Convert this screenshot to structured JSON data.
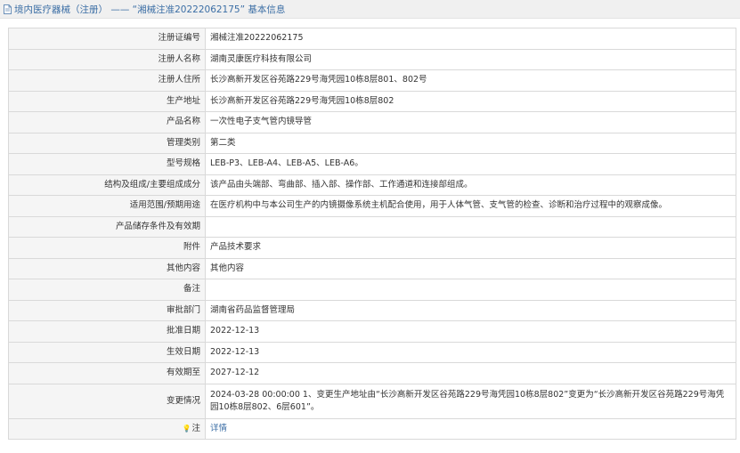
{
  "header": {
    "title": "境内医疗器械（注册） —— “湘械注准20222062175” 基本信息"
  },
  "rows": [
    {
      "label": "注册证编号",
      "value": "湘械注准20222062175"
    },
    {
      "label": "注册人名称",
      "value": "湖南灵康医疗科技有限公司"
    },
    {
      "label": "注册人住所",
      "value": "长沙高新开发区谷苑路229号海凭园10栋8层801、802号"
    },
    {
      "label": "生产地址",
      "value": "长沙高新开发区谷苑路229号海凭园10栋8层802"
    },
    {
      "label": "产品名称",
      "value": "一次性电子支气管内镜导管"
    },
    {
      "label": "管理类别",
      "value": "第二类"
    },
    {
      "label": "型号规格",
      "value": "LEB-P3、LEB-A4、LEB-A5、LEB-A6。"
    },
    {
      "label": "结构及组成/主要组成成分",
      "value": "该产品由头端部、弯曲部、插入部、操作部、工作通道和连接部组成。"
    },
    {
      "label": "适用范围/预期用途",
      "value": "在医疗机构中与本公司生产的内镜摄像系统主机配合使用，用于人体气管、支气管的检查、诊断和治疗过程中的观察成像。"
    },
    {
      "label": "产品储存条件及有效期",
      "value": ""
    },
    {
      "label": "附件",
      "value": "产品技术要求"
    },
    {
      "label": "其他内容",
      "value": "其他内容"
    },
    {
      "label": "备注",
      "value": ""
    },
    {
      "label": "审批部门",
      "value": "湖南省药品监督管理局"
    },
    {
      "label": "批准日期",
      "value": "2022-12-13"
    },
    {
      "label": "生效日期",
      "value": "2022-12-13"
    },
    {
      "label": "有效期至",
      "value": "2027-12-12"
    },
    {
      "label": "变更情况",
      "value": "2024-03-28 00:00:00 1、变更生产地址由“长沙高新开发区谷苑路229号海凭园10栋8层802”变更为“长沙高新开发区谷苑路229号海凭园10栋8层802、6层601”。"
    }
  ],
  "note_row": {
    "label": "注",
    "icon": "lightbulb-icon",
    "link_text": "详情"
  }
}
